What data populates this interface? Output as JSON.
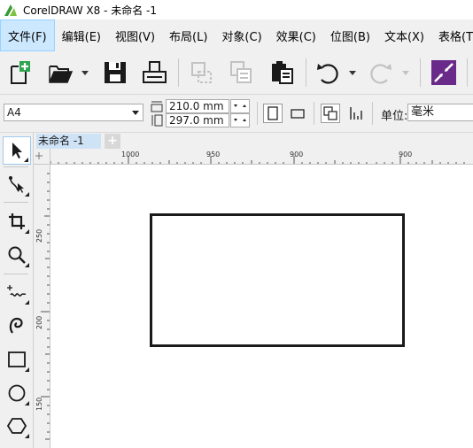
{
  "window": {
    "title": "CorelDRAW X8 - 未命名 -1"
  },
  "menu": {
    "items": [
      {
        "label": "文件(F)",
        "active": true
      },
      {
        "label": "编辑(E)"
      },
      {
        "label": "视图(V)"
      },
      {
        "label": "布局(L)"
      },
      {
        "label": "对象(C)"
      },
      {
        "label": "效果(C)"
      },
      {
        "label": "位图(B)"
      },
      {
        "label": "文本(X)"
      },
      {
        "label": "表格(T)"
      }
    ]
  },
  "toolbar": {
    "icons": [
      "new-document-icon",
      "open-folder-icon",
      "save-icon",
      "print-icon",
      "cut-icon",
      "copy-icon",
      "paste-icon",
      "undo-icon",
      "redo-icon",
      "import-export-icon"
    ]
  },
  "propbar": {
    "page_size": "A4",
    "width": "210.0 mm",
    "height": "297.0 mm",
    "unit_label": "单位:",
    "unit_value": "毫米"
  },
  "tabs": {
    "document": "未命名 -1",
    "add": "+"
  },
  "ruler": {
    "horizontal": [
      "1000",
      "950",
      "900",
      "900"
    ],
    "vertical": [
      "250",
      "200",
      "150"
    ]
  },
  "colors": {
    "accent_tab": "#cfe3f7",
    "active_menu": "#cce8ff",
    "chrome": "#f0f0f0",
    "shape_stroke": "#1a1a1a"
  }
}
